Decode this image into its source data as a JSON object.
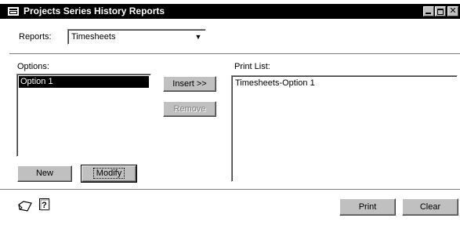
{
  "window": {
    "title": "Projects Series History Reports"
  },
  "reports": {
    "label": "Reports:",
    "value": "Timesheets"
  },
  "options": {
    "label": "Options:",
    "items": [
      "Option 1"
    ]
  },
  "print_list": {
    "label": "Print List:",
    "items": [
      "Timesheets-Option 1"
    ]
  },
  "buttons": {
    "insert": "Insert >>",
    "remove": "Remove",
    "new": "New",
    "modify": "Modify",
    "print": "Print",
    "clear": "Clear"
  },
  "icons": [
    "notes-icon",
    "help-icon"
  ]
}
